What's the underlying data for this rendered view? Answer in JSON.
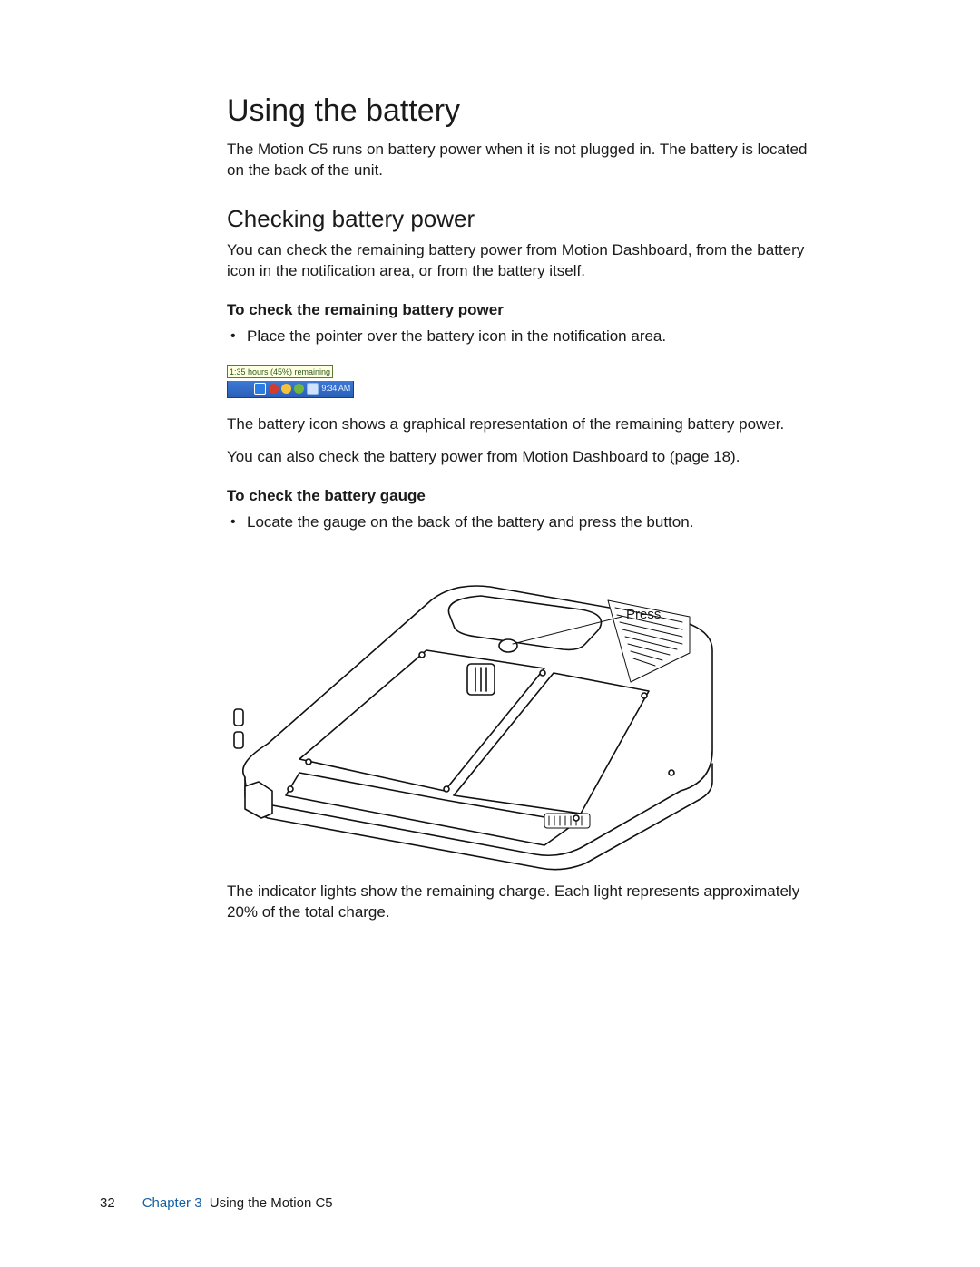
{
  "heading": "Using the battery",
  "intro": "The Motion C5 runs on battery power when it is not plugged in. The battery is located on the back of the unit.",
  "sub1": {
    "title": "Checking battery power",
    "intro": "You can check the remaining battery power from Motion Dashboard, from the battery icon in the notification area, or from the battery itself.",
    "howto1_title": "To check the remaining battery power",
    "howto1_item": "Place the pointer over the battery icon in the notification area.",
    "tray_tooltip": "1:35 hours (45%) remaining",
    "tray_time": "9:34 AM",
    "after_tray_1": "The battery icon shows a graphical representation of the remaining battery power.",
    "after_tray_2": "You can also check the battery power from Motion Dashboard to (page 18).",
    "howto2_title": "To check the battery gauge",
    "howto2_item": "Locate the gauge on the back of the battery and press the button.",
    "press_label": "Press",
    "after_fig": "The indicator lights show the remaining charge. Each light represents approximately 20% of the total charge."
  },
  "footer": {
    "page_number": "32",
    "chapter_label": "Chapter 3",
    "chapter_title": "Using the Motion C5"
  }
}
